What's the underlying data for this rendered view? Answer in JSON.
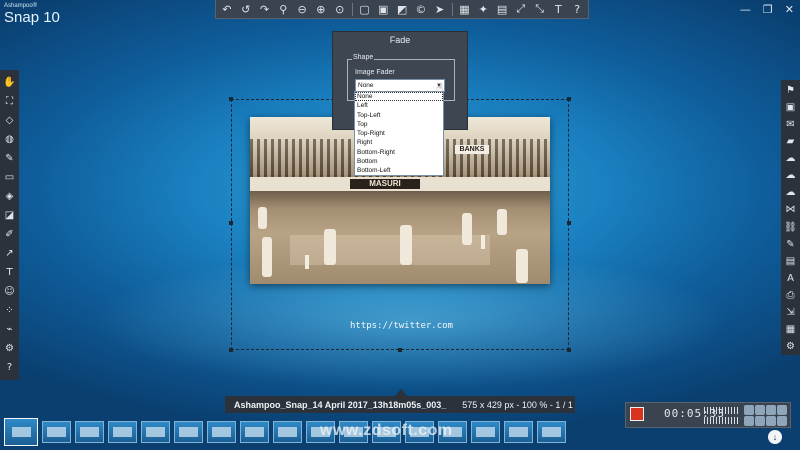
{
  "app": {
    "brand_small": "Ashampoo®",
    "brand_name": "Snap 10"
  },
  "window_controls": [
    {
      "name": "minimize-icon",
      "glyph": "—"
    },
    {
      "name": "restore-icon",
      "glyph": "❐"
    },
    {
      "name": "close-icon",
      "glyph": "✕"
    }
  ],
  "top_toolbar": [
    {
      "name": "undo-icon",
      "glyph": "↶"
    },
    {
      "name": "undo-step-icon",
      "glyph": "↺"
    },
    {
      "name": "redo-icon",
      "glyph": "↷"
    },
    {
      "name": "zoom-icon",
      "glyph": "⚲"
    },
    {
      "name": "zoom-out-icon",
      "glyph": "⊖"
    },
    {
      "name": "zoom-in-icon",
      "glyph": "⊕"
    },
    {
      "name": "zoom-fit-icon",
      "glyph": "⊙"
    },
    {
      "name": "sep"
    },
    {
      "name": "crop-icon",
      "glyph": "▢"
    },
    {
      "name": "border-icon",
      "glyph": "▣"
    },
    {
      "name": "color-icon",
      "glyph": "◩"
    },
    {
      "name": "copyright-icon",
      "glyph": "©"
    },
    {
      "name": "cursor-icon",
      "glyph": "➤"
    },
    {
      "name": "sep"
    },
    {
      "name": "calendar-icon",
      "glyph": "▦"
    },
    {
      "name": "magic-wand-icon",
      "glyph": "✦"
    },
    {
      "name": "image-icon",
      "glyph": "▤"
    },
    {
      "name": "resize-icon",
      "glyph": "⤢"
    },
    {
      "name": "expand-icon",
      "glyph": "⤡"
    },
    {
      "name": "text-icon",
      "glyph": "T"
    },
    {
      "name": "help-icon",
      "glyph": "?"
    }
  ],
  "left_tools": [
    {
      "name": "smart-tool-icon",
      "glyph": "✋"
    },
    {
      "name": "crop-tool-icon",
      "glyph": "⛶"
    },
    {
      "name": "eraser-icon",
      "glyph": "◇"
    },
    {
      "name": "blur-icon",
      "glyph": "◍"
    },
    {
      "name": "highlighter-icon",
      "glyph": "✎"
    },
    {
      "name": "selection-icon",
      "glyph": "▭"
    },
    {
      "name": "fill-icon",
      "glyph": "◈"
    },
    {
      "name": "shapes-icon",
      "glyph": "◪"
    },
    {
      "name": "pen-icon",
      "glyph": "✐"
    },
    {
      "name": "arrow-icon",
      "glyph": "↗"
    },
    {
      "name": "text-tool-icon",
      "glyph": "T"
    },
    {
      "name": "stamp-icon",
      "glyph": "☺"
    },
    {
      "name": "numbering-icon",
      "glyph": "⁘"
    },
    {
      "name": "brush-icon",
      "glyph": "⌁"
    },
    {
      "name": "settings-icon",
      "glyph": "⚙"
    },
    {
      "name": "help-left-icon",
      "glyph": "?"
    }
  ],
  "right_tools": [
    {
      "name": "pin-icon",
      "glyph": "⚑"
    },
    {
      "name": "save-icon",
      "glyph": "▣"
    },
    {
      "name": "email-icon",
      "glyph": "✉"
    },
    {
      "name": "folder-icon",
      "glyph": "▰"
    },
    {
      "name": "cloud-icon",
      "glyph": "☁"
    },
    {
      "name": "cloud-upload-icon",
      "glyph": "☁"
    },
    {
      "name": "cloud-download-icon",
      "glyph": "☁"
    },
    {
      "name": "share-icon",
      "glyph": "⋈"
    },
    {
      "name": "link-icon",
      "glyph": "⛓"
    },
    {
      "name": "edit-icon",
      "glyph": "✎"
    },
    {
      "name": "document-icon",
      "glyph": "▤"
    },
    {
      "name": "ocr-icon",
      "glyph": "A"
    },
    {
      "name": "print-icon",
      "glyph": "⎙"
    },
    {
      "name": "export-icon",
      "glyph": "⇲"
    },
    {
      "name": "film-icon",
      "glyph": "▦"
    },
    {
      "name": "gear-right-icon",
      "glyph": "⚙"
    }
  ],
  "photo": {
    "banner_masuri": "MASURI",
    "banner_banks": "BANKS"
  },
  "url_overlay": "https://twitter.com",
  "fade_dialog": {
    "title": "Fade",
    "group_label": "Shape",
    "field_label": "Image Fader",
    "selected": "None",
    "options": [
      "None",
      "Left",
      "Top-Left",
      "Top",
      "Top-Right",
      "Right",
      "Bottom-Right",
      "Bottom",
      "Bottom-Left"
    ]
  },
  "info_bar": {
    "filename": "Ashampoo_Snap_14 April 2017_13h18m05s_003_",
    "meta": "575 x 429 px - 100 % - 1 / 1"
  },
  "thumbnail_count": 17,
  "watermark": "www.zdsoft.com",
  "recorder": {
    "timer": "00:05:33"
  },
  "colors": {
    "toolbar_bg": "#3a4350",
    "record_red": "#d8331f"
  }
}
